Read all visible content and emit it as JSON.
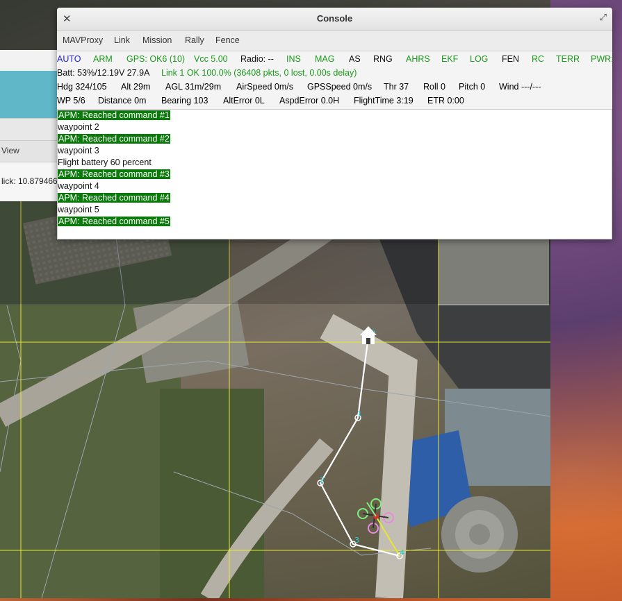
{
  "console": {
    "title": "Console",
    "menu": [
      "MAVProxy",
      "Link",
      "Mission",
      "Rally",
      "Fence"
    ],
    "status_row1": [
      {
        "text": "AUTO",
        "color": "#1f1fd6"
      },
      {
        "text": "ARM",
        "color": "#1a9a1a"
      },
      {
        "text": "GPS: OK6 (10)",
        "color": "#1a9a1a"
      },
      {
        "text": "Vcc 5.00",
        "color": "#1a9a1a"
      },
      {
        "text": "Radio: --",
        "color": "#111111"
      },
      {
        "text": "INS",
        "color": "#1a9a1a"
      },
      {
        "text": "MAG",
        "color": "#1a9a1a"
      },
      {
        "text": "AS",
        "color": "#111111"
      },
      {
        "text": "RNG",
        "color": "#111111"
      },
      {
        "text": "AHRS",
        "color": "#1a9a1a"
      },
      {
        "text": "EKF",
        "color": "#1a9a1a"
      },
      {
        "text": "LOG",
        "color": "#1a9a1a"
      },
      {
        "text": "FEN",
        "color": "#111111"
      },
      {
        "text": "RC",
        "color": "#1a9a1a"
      },
      {
        "text": "TERR",
        "color": "#1a9a1a"
      },
      {
        "text": "PWR:",
        "color": "#1a9a1a"
      }
    ],
    "status_row2": [
      {
        "text": "Batt: 53%/12.19V 27.9A",
        "color": "#111111"
      },
      {
        "text": "Link 1 OK 100.0% (36408 pkts, 0 lost, 0.00s delay)",
        "color": "#1a9a1a"
      }
    ],
    "status_row3": [
      "Hdg 324/105",
      "Alt 29m",
      "AGL 31m/29m",
      "AirSpeed 0m/s",
      "GPSSpeed 0m/s",
      "Thr 37",
      "Roll 0",
      "Pitch 0",
      "Wind ---/---"
    ],
    "status_row4": [
      "WP 5/6",
      "Distance 0m",
      "Bearing 103",
      "AltError 0L",
      "AspdError 0.0H",
      "FlightTime 3:19",
      "ETR 0:00"
    ],
    "log": [
      {
        "text": "APM: Reached command #1",
        "highlight": true
      },
      {
        "text": "waypoint 2",
        "highlight": false
      },
      {
        "text": "APM: Reached command #2",
        "highlight": true
      },
      {
        "text": "waypoint 3",
        "highlight": false
      },
      {
        "text": "Flight battery 60 percent",
        "highlight": false
      },
      {
        "text": "APM: Reached command #3",
        "highlight": true
      },
      {
        "text": "waypoint 4",
        "highlight": false
      },
      {
        "text": "APM: Reached command #4",
        "highlight": true
      },
      {
        "text": "waypoint 5",
        "highlight": false
      },
      {
        "text": "APM: Reached command #5",
        "highlight": true
      }
    ]
  },
  "background_window": {
    "menu_label": "View",
    "status_text": "lick: 10.879466"
  },
  "map": {
    "waypoint_labels": [
      "0",
      "1",
      "2",
      "3",
      "4"
    ],
    "colors": {
      "grid": "#e8e830",
      "route": "#ffffff",
      "leg": "#e8e830"
    }
  }
}
